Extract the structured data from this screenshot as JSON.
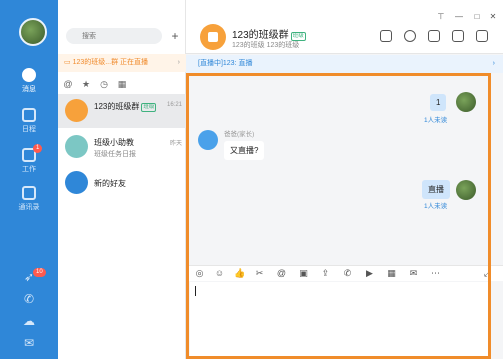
{
  "rail": {
    "items": [
      {
        "label": "消息",
        "active": true
      },
      {
        "label": "日程"
      },
      {
        "label": "工作",
        "badge": "1"
      },
      {
        "label": "通讯录"
      }
    ],
    "live_badge": "10"
  },
  "list": {
    "search_placeholder": "搜索",
    "live_banner": "123的班级...群 正在直播",
    "conversations": [
      {
        "name": "123的班级群",
        "tag": "班级",
        "sub": "",
        "time": "16:21"
      },
      {
        "name": "班级小助教",
        "sub": "班级任务日报",
        "time": "昨天"
      },
      {
        "name": "新的好友",
        "sub": "",
        "time": ""
      }
    ]
  },
  "chat": {
    "title": "123的班级群",
    "tag": "班级",
    "subtitle": "123的班级 123的班级",
    "live_bar": "[直播中]123: 直播",
    "messages": [
      {
        "text": "1",
        "unread": "1人未读"
      },
      {
        "sender": "爸爸(家长)",
        "text": "又直播?"
      },
      {
        "text": "直播",
        "unread": "1人未读"
      }
    ]
  },
  "colors": {
    "rail": "#2f87d8",
    "highlight": "#f08c2a",
    "group_avatar": "#f7a13b"
  }
}
